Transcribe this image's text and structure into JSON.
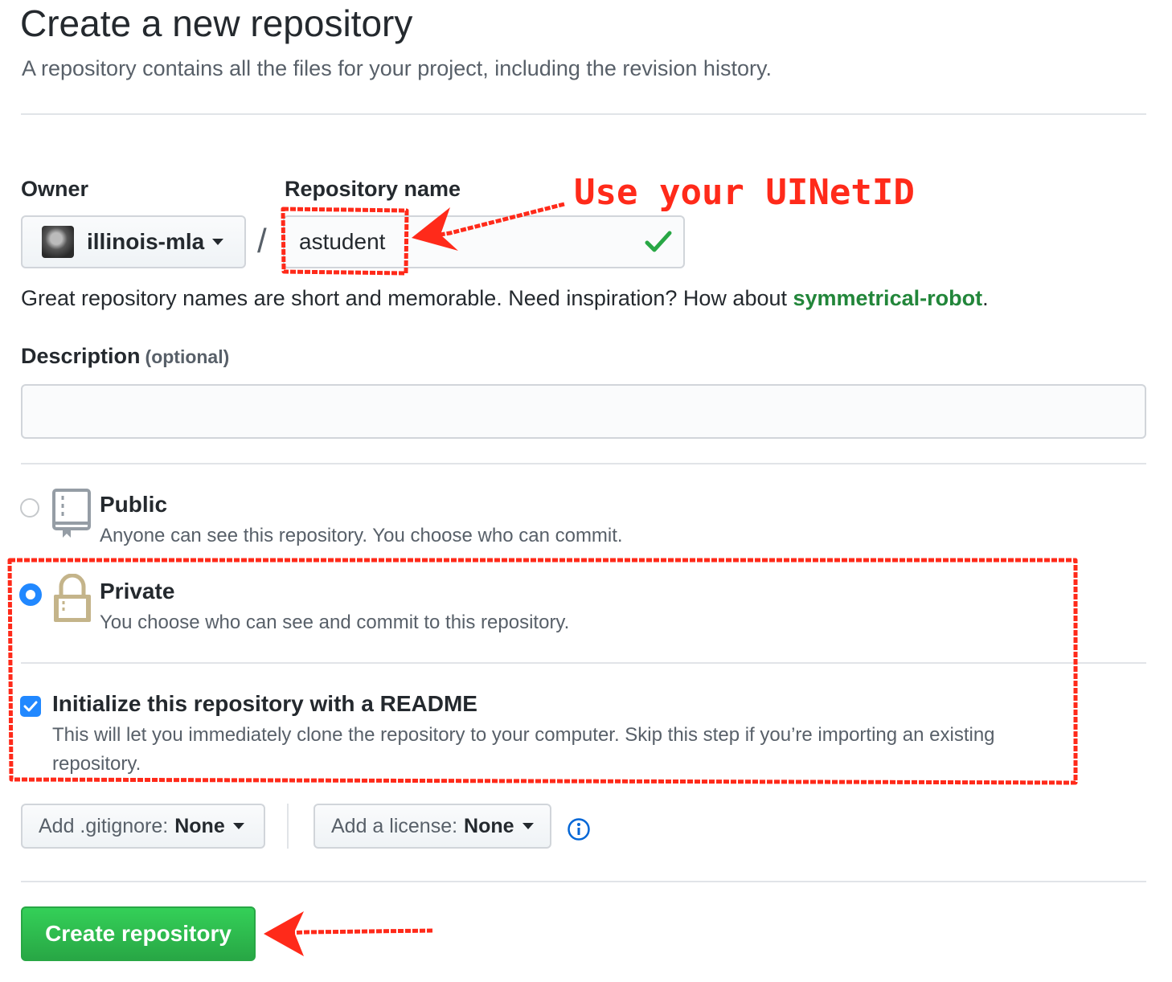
{
  "header": {
    "title": "Create a new repository",
    "subtitle": "A repository contains all the files for your project, including the revision history."
  },
  "owner": {
    "label": "Owner",
    "value": "illinois-mla"
  },
  "separator": "/",
  "repo_name": {
    "label": "Repository name",
    "value": "astudent",
    "status_icon": "check-icon"
  },
  "hint": {
    "prefix": "Great repository names are short and memorable. Need inspiration? How about ",
    "suggestion": "symmetrical-robot",
    "suffix": "."
  },
  "description": {
    "label": "Description",
    "optional": "(optional)",
    "value": ""
  },
  "visibility": {
    "public": {
      "title": "Public",
      "desc": "Anyone can see this repository. You choose who can commit.",
      "checked": false
    },
    "private": {
      "title": "Private",
      "desc": "You choose who can see and commit to this repository.",
      "checked": true
    }
  },
  "readme": {
    "title": "Initialize this repository with a README",
    "desc_line1": "This will let you immediately clone the repository to your computer. Skip this step if you’re importing an existing",
    "desc_line2": "repository.",
    "checked": true
  },
  "gitignore": {
    "label": "Add .gitignore:",
    "value": "None"
  },
  "license": {
    "label": "Add a license:",
    "value": "None"
  },
  "submit_label": "Create repository",
  "annotation": {
    "text": "Use your UINetID",
    "color": "#ff2a1a"
  },
  "colors": {
    "primary_green": "#28a745",
    "link_green": "#22863a",
    "radio_blue": "#2188ff"
  }
}
